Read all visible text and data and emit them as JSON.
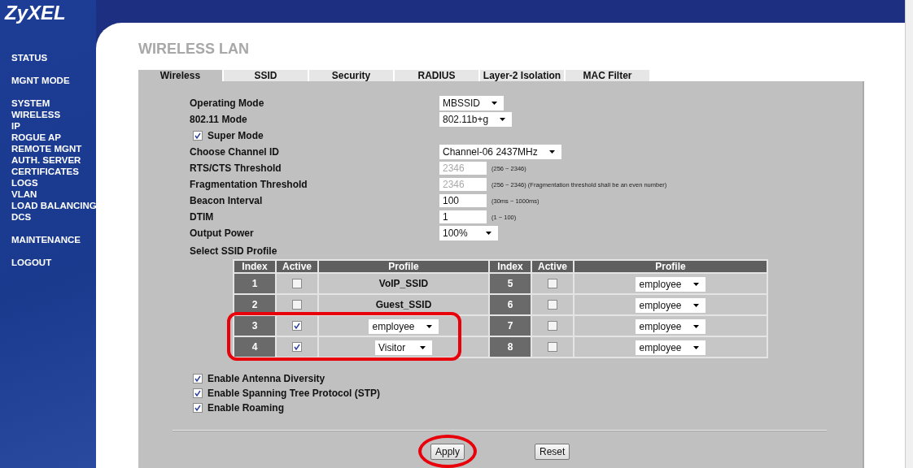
{
  "logo": "ZyXEL",
  "sidebar": {
    "groups": [
      {
        "items": [
          "STATUS"
        ]
      },
      {
        "items": [
          "MGNT MODE"
        ]
      },
      {
        "items": [
          "SYSTEM",
          "WIRELESS",
          "IP",
          "ROGUE AP",
          "REMOTE MGNT",
          "AUTH. SERVER",
          "CERTIFICATES",
          "LOGS",
          "VLAN",
          "LOAD BALANCING",
          "DCS"
        ]
      },
      {
        "items": [
          "MAINTENANCE"
        ]
      },
      {
        "items": [
          "LOGOUT"
        ]
      }
    ]
  },
  "page_title": "WIRELESS LAN",
  "tabs": [
    {
      "label": "Wireless",
      "selected": true
    },
    {
      "label": "SSID",
      "selected": false
    },
    {
      "label": "Security",
      "selected": false
    },
    {
      "label": "RADIUS",
      "selected": false
    },
    {
      "label": "Layer-2 Isolation",
      "selected": false
    },
    {
      "label": "MAC Filter",
      "selected": false
    }
  ],
  "form": [
    {
      "kind": "select",
      "label": "Operating Mode",
      "value": "MBSSID"
    },
    {
      "kind": "select",
      "label": "802.11 Mode",
      "value": "802.11b+g"
    },
    {
      "kind": "checkbox",
      "label": "Super Mode",
      "checked": true
    },
    {
      "kind": "select",
      "label": "Choose Channel ID",
      "value": "Channel-06 2437MHz"
    },
    {
      "kind": "input",
      "label": "RTS/CTS Threshold",
      "value": "2346",
      "disabled": true,
      "hint": "(256 ~ 2346)"
    },
    {
      "kind": "input",
      "label": "Fragmentation Threshold",
      "value": "2346",
      "disabled": true,
      "hint": "(256 ~ 2346) (Fragmentation threshold shall be an even number)"
    },
    {
      "kind": "input",
      "label": "Beacon Interval",
      "value": "100",
      "disabled": false,
      "hint": "(30ms ~ 1000ms)"
    },
    {
      "kind": "input",
      "label": "DTIM",
      "value": "1",
      "disabled": false,
      "hint": "(1 ~ 100)"
    },
    {
      "kind": "select",
      "label": "Output Power",
      "value": "100%"
    }
  ],
  "ssid_section": {
    "title": "Select SSID Profile",
    "columns": [
      "Index",
      "Active",
      "Profile",
      "Index",
      "Active",
      "Profile"
    ],
    "entries": [
      {
        "index": "1",
        "active": false,
        "kind": "text",
        "profile": "VoIP_SSID",
        "highlighted": false
      },
      {
        "index": "2",
        "active": false,
        "kind": "text",
        "profile": "Guest_SSID",
        "highlighted": false
      },
      {
        "index": "3",
        "active": true,
        "kind": "select",
        "profile": "employee",
        "highlighted": true
      },
      {
        "index": "4",
        "active": true,
        "kind": "select",
        "profile": "Visitor",
        "highlighted": true
      },
      {
        "index": "5",
        "active": false,
        "kind": "select",
        "profile": "employee",
        "highlighted": false
      },
      {
        "index": "6",
        "active": false,
        "kind": "select",
        "profile": "employee",
        "highlighted": false
      },
      {
        "index": "7",
        "active": false,
        "kind": "select",
        "profile": "employee",
        "highlighted": false
      },
      {
        "index": "8",
        "active": false,
        "kind": "select",
        "profile": "employee",
        "highlighted": false
      }
    ]
  },
  "options": [
    {
      "label": "Enable Antenna Diversity",
      "checked": true
    },
    {
      "label": "Enable Spanning Tree Protocol (STP)",
      "checked": true
    },
    {
      "label": "Enable Roaming",
      "checked": true
    }
  ],
  "buttons": [
    {
      "label": "Apply",
      "highlighted": true
    },
    {
      "label": "Reset",
      "highlighted": false
    }
  ]
}
